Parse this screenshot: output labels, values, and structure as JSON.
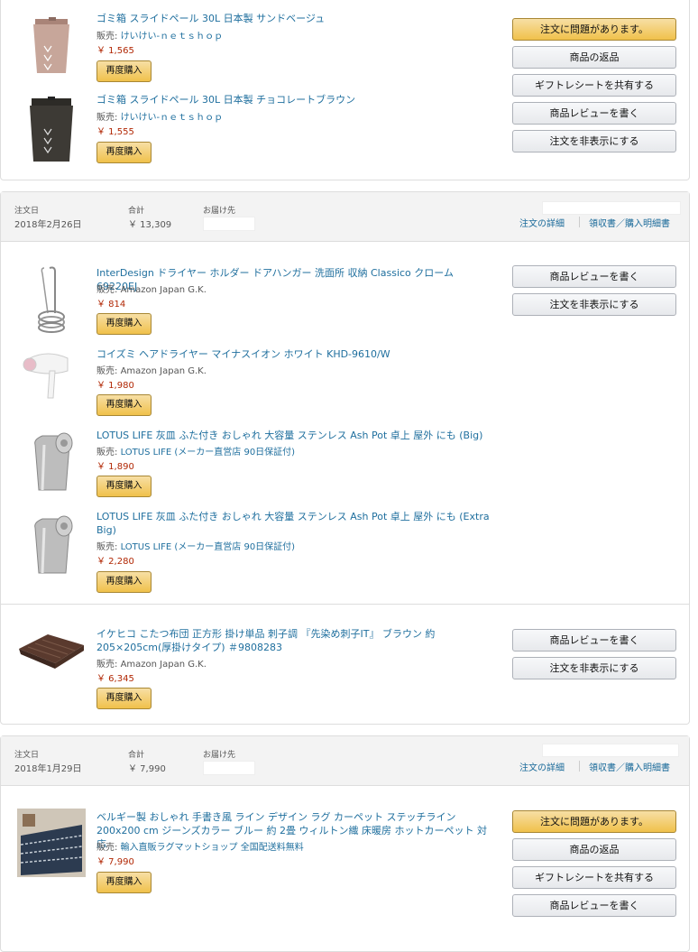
{
  "labels": {
    "rebuy": "再度購入",
    "order_date": "注文日",
    "total": "合計",
    "ship_to": "お届け先",
    "order_details": "注文の詳細",
    "receipt": "領収書／購入明細書",
    "problem": "注文に問題があります。",
    "return": "商品の返品",
    "gift": "ギフトレシートを共有する",
    "review": "商品レビューを書く",
    "hide": "注文を非表示にする",
    "seller_prefix": "販売: "
  },
  "order0": {
    "items": [
      {
        "title": "ゴミ箱 スライドペール 30L 日本製 サンドベージュ",
        "seller": "けいけい-ｎｅｔｓｈｏｐ",
        "price": "￥ 1,565"
      },
      {
        "title": "ゴミ箱 スライドペール 30L 日本製 チョコレートブラウン",
        "seller": "けいけい-ｎｅｔｓｈｏｐ",
        "price": "￥ 1,555"
      }
    ]
  },
  "order1": {
    "date": "2018年2月26日",
    "total": "￥ 13,309",
    "items": [
      {
        "title": "InterDesign ドライヤー ホルダー ドアハンガー 洗面所 収納 Classico クローム 69220EJ",
        "seller": "Amazon Japan G.K.",
        "price": "￥ 814"
      },
      {
        "title": "コイズミ ヘアドライヤー マイナスイオン ホワイト KHD-9610/W",
        "seller": "Amazon Japan G.K.",
        "price": "￥ 1,980"
      },
      {
        "title": "LOTUS LIFE 灰皿 ふた付き おしゃれ 大容量 ステンレス Ash Pot 卓上 屋外 にも (Big)",
        "seller": "LOTUS LIFE (メーカー直営店 90日保証付)",
        "price": "￥ 1,890"
      },
      {
        "title": "LOTUS LIFE 灰皿 ふた付き おしゃれ 大容量 ステンレス Ash Pot 卓上 屋外 にも (Extra Big)",
        "seller": "LOTUS LIFE (メーカー直営店 90日保証付)",
        "price": "￥ 2,280"
      },
      {
        "title": "イケヒコ こたつ布団 正方形 掛け単品 刺子調 『先染め刺子IT』 ブラウン 約205×205cm(厚掛けタイプ) ＃9808283",
        "seller": "Amazon Japan G.K.",
        "price": "￥ 6,345"
      }
    ]
  },
  "order2": {
    "date": "2018年1月29日",
    "total": "￥ 7,990",
    "items": [
      {
        "title": "ベルギー製 おしゃれ 手書き風 ライン デザイン ラグ カーペット ステッチライン 200x200 cm ジーンズカラー ブルー 約 2畳 ウィルトン織 床暖房 ホットカーペット 対応",
        "seller": "輸入直販ラグマットショップ 全国配送料無料",
        "price": "￥ 7,990"
      }
    ]
  },
  "icons": [
    "trash-bin-beige-icon",
    "trash-bin-brown-icon",
    "dryer-holder-icon",
    "hair-dryer-icon",
    "ash-pot-icon",
    "kotatsu-futon-icon",
    "rug-icon"
  ]
}
